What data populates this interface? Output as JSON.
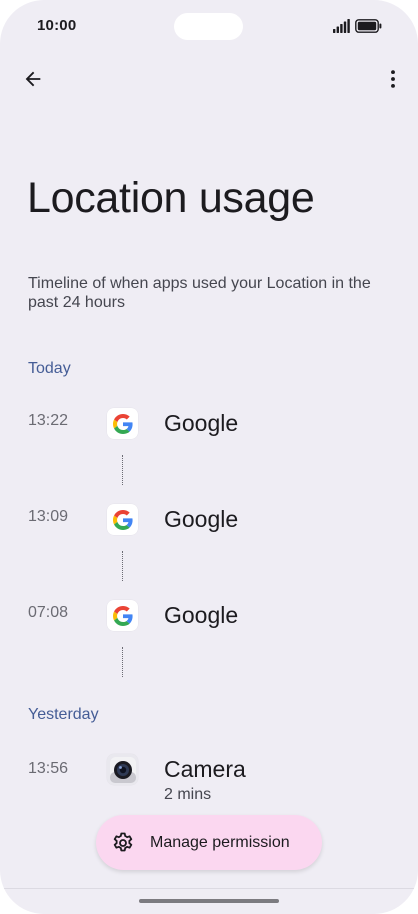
{
  "status_bar": {
    "time": "10:00",
    "signal_icon": "cellular-signal-icon",
    "battery_icon": "battery-full-icon"
  },
  "app_bar": {
    "back_icon": "arrow-back-icon",
    "more_icon": "more-vert-icon"
  },
  "title": "Location usage",
  "subtitle": "Timeline of when apps used your Location in the past 24 hours",
  "sections": [
    {
      "header": "Today",
      "entries": [
        {
          "time": "13:22",
          "app": "Google",
          "icon": "google-icon"
        },
        {
          "time": "13:09",
          "app": "Google",
          "icon": "google-icon"
        },
        {
          "time": "07:08",
          "app": "Google",
          "icon": "google-icon"
        }
      ]
    },
    {
      "header": "Yesterday",
      "entries": [
        {
          "time": "13:56",
          "app": "Camera",
          "detail": "2 mins",
          "icon": "camera-icon"
        }
      ]
    }
  ],
  "fab": {
    "label": "Manage permission",
    "icon": "gear-icon"
  },
  "colors": {
    "background": "#efedf4",
    "section_header": "#455d96",
    "fab_background": "#fbd7f0"
  }
}
